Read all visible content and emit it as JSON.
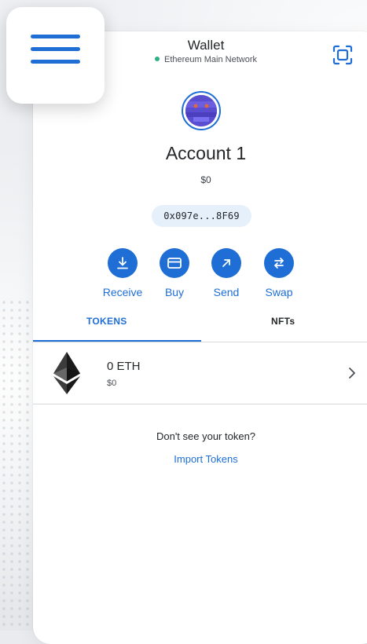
{
  "header": {
    "title": "Wallet",
    "network": "Ethereum Main Network"
  },
  "account": {
    "name": "Account 1",
    "balance": "$0",
    "address": "0x097e...8F69"
  },
  "actions": [
    {
      "label": "Receive",
      "icon": "download-icon"
    },
    {
      "label": "Buy",
      "icon": "card-icon"
    },
    {
      "label": "Send",
      "icon": "arrow-up-right-icon"
    },
    {
      "label": "Swap",
      "icon": "swap-icon"
    }
  ],
  "tabs": [
    {
      "label": "TOKENS",
      "active": true
    },
    {
      "label": "NFTs",
      "active": false
    }
  ],
  "tokens": [
    {
      "amount": "0 ETH",
      "fiat": "$0",
      "icon": "ethereum-icon"
    }
  ],
  "empty_state": {
    "prompt": "Don't see your token?",
    "link": "Import Tokens"
  },
  "colors": {
    "accent": "#1e6ed6",
    "network_dot": "#2eb086",
    "address_pill": "#e6f0fb"
  }
}
